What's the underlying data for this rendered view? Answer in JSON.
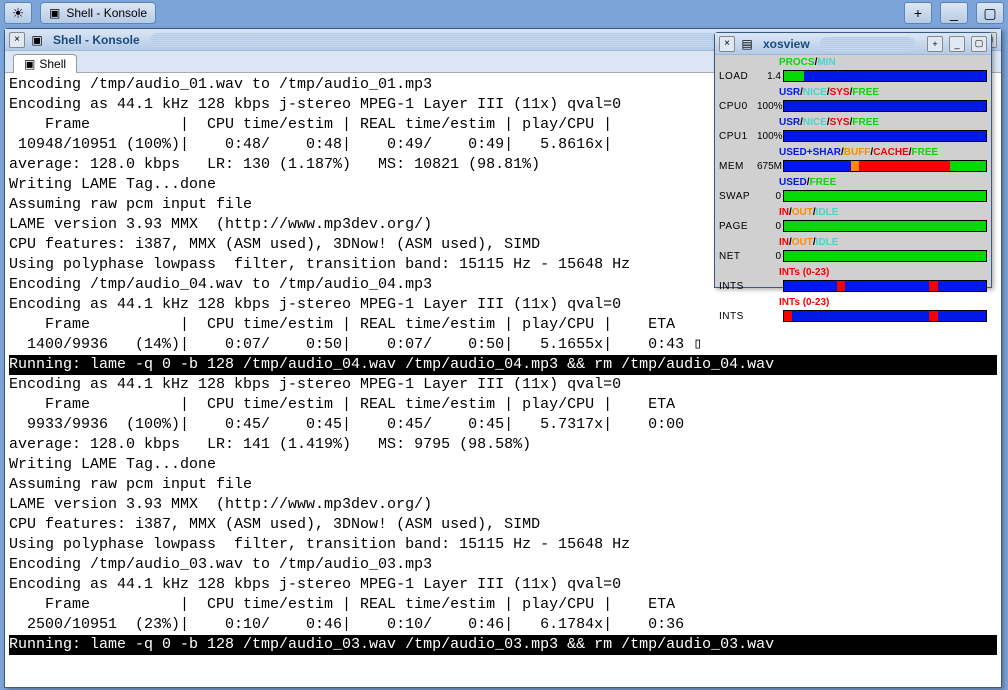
{
  "taskbar": {
    "items": [
      {
        "label": "Shell - Konsole",
        "glyph": "▣"
      }
    ]
  },
  "konsole": {
    "title": "Shell - Konsole",
    "tab_label": "Shell",
    "lines": [
      "Encoding /tmp/audio_01.wav to /tmp/audio_01.mp3",
      "Encoding as 44.1 kHz 128 kbps j-stereo MPEG-1 Layer III (11x) qval=0",
      "    Frame          |  CPU time/estim | REAL time/estim | play/CPU |",
      " 10948/10951 (100%)|    0:48/    0:48|    0:49/    0:49|   5.8616x|",
      "average: 128.0 kbps   LR: 130 (1.187%)   MS: 10821 (98.81%)",
      "",
      "Writing LAME Tag...done",
      "Assuming raw pcm input file",
      "LAME version 3.93 MMX  (http://www.mp3dev.org/)",
      "CPU features: i387, MMX (ASM used), 3DNow! (ASM used), SIMD",
      "Using polyphase lowpass  filter, transition band: 15115 Hz - 15648 Hz",
      "Encoding /tmp/audio_04.wav to /tmp/audio_04.mp3",
      "Encoding as 44.1 kHz 128 kbps j-stereo MPEG-1 Layer III (11x) qval=0",
      "    Frame          |  CPU time/estim | REAL time/estim | play/CPU |    ETA",
      "  1400/9936   (14%)|    0:07/    0:50|    0:07/    0:50|   5.1655x|    0:43 ▯",
      "Running: lame -q 0 -b 128 /tmp/audio_04.wav /tmp/audio_04.mp3 && rm /tmp/audio_04.wav",
      "Encoding as 44.1 kHz 128 kbps j-stereo MPEG-1 Layer III (11x) qval=0",
      "    Frame          |  CPU time/estim | REAL time/estim | play/CPU |    ETA",
      "  9933/9936  (100%)|    0:45/    0:45|    0:45/    0:45|   5.7317x|    0:00",
      "average: 128.0 kbps   LR: 141 (1.419%)   MS: 9795 (98.58%)",
      "",
      "Writing LAME Tag...done",
      "Assuming raw pcm input file",
      "LAME version 3.93 MMX  (http://www.mp3dev.org/)",
      "CPU features: i387, MMX (ASM used), 3DNow! (ASM used), SIMD",
      "Using polyphase lowpass  filter, transition band: 15115 Hz - 15648 Hz",
      "Encoding /tmp/audio_03.wav to /tmp/audio_03.mp3",
      "Encoding as 44.1 kHz 128 kbps j-stereo MPEG-1 Layer III (11x) qval=0",
      "    Frame          |  CPU time/estim | REAL time/estim | play/CPU |    ETA",
      "  2500/10951  (23%)|    0:10/    0:46|    0:10/    0:46|   6.1784x|    0:36",
      "Running: lame -q 0 -b 128 /tmp/audio_03.wav /tmp/audio_03.mp3 && rm /tmp/audio_03.wav"
    ],
    "inverse_line_indices": [
      15,
      30
    ]
  },
  "xosview": {
    "title": "xosview",
    "rows": [
      {
        "legend": [
          [
            "PROCS",
            "#06d806"
          ],
          [
            "/",
            ""
          ],
          [
            "MIN",
            "#4ad4c8"
          ]
        ],
        "label": "LOAD",
        "value": "1.4",
        "segments": [
          [
            "c-green",
            10
          ],
          [
            "c-blue",
            90
          ]
        ]
      },
      {
        "legend": [
          [
            "USR",
            "#0018e8"
          ],
          [
            "/",
            ""
          ],
          [
            "NICE",
            "#4ad4c8"
          ],
          [
            "/",
            ""
          ],
          [
            "SYS",
            "#f80000"
          ],
          [
            "/",
            ""
          ],
          [
            "FREE",
            "#06d806"
          ]
        ],
        "label": "CPU0",
        "value": "100%",
        "segments": [
          [
            "c-blue",
            100
          ]
        ]
      },
      {
        "legend": [
          [
            "USR",
            "#0018e8"
          ],
          [
            "/",
            ""
          ],
          [
            "NICE",
            "#4ad4c8"
          ],
          [
            "/",
            ""
          ],
          [
            "SYS",
            "#f80000"
          ],
          [
            "/",
            ""
          ],
          [
            "FREE",
            "#06d806"
          ]
        ],
        "label": "CPU1",
        "value": "100%",
        "segments": [
          [
            "c-blue",
            100
          ]
        ]
      },
      {
        "legend": [
          [
            "USED+SHAR",
            "#0018e8"
          ],
          [
            "/",
            ""
          ],
          [
            "BUFF",
            "#ff8a00"
          ],
          [
            "/",
            ""
          ],
          [
            "CACHE",
            "#f80000"
          ],
          [
            "/",
            ""
          ],
          [
            "FREE",
            "#06d806"
          ]
        ],
        "label": "MEM",
        "value": "675M",
        "segments": [
          [
            "c-blue",
            33
          ],
          [
            "c-orange",
            4
          ],
          [
            "c-red",
            45
          ],
          [
            "c-green",
            18
          ]
        ]
      },
      {
        "legend": [
          [
            "USED",
            "#0018e8"
          ],
          [
            "/",
            ""
          ],
          [
            "FREE",
            "#06d806"
          ]
        ],
        "label": "SWAP",
        "value": "0",
        "segments": [
          [
            "c-green",
            100
          ]
        ]
      },
      {
        "legend": [
          [
            "IN",
            "#f80000"
          ],
          [
            "/",
            ""
          ],
          [
            "OUT",
            "#ff8a00"
          ],
          [
            "/",
            ""
          ],
          [
            "IDLE",
            "#4ad4c8"
          ]
        ],
        "label": "PAGE",
        "value": "0",
        "segments": [
          [
            "c-green",
            100
          ]
        ]
      },
      {
        "legend": [
          [
            "IN",
            "#f80000"
          ],
          [
            "/",
            ""
          ],
          [
            "OUT",
            "#ff8a00"
          ],
          [
            "/",
            ""
          ],
          [
            "IDLE",
            "#4ad4c8"
          ]
        ],
        "label": "NET",
        "value": "0",
        "segments": [
          [
            "c-green",
            100
          ]
        ]
      },
      {
        "legend": [
          [
            "INTs (0-23)",
            "#f80000"
          ]
        ],
        "label": "INTS",
        "value": "",
        "segments": [
          [
            "c-blue",
            26
          ],
          [
            "c-red",
            4
          ],
          [
            "c-blue",
            42
          ],
          [
            "c-red",
            4
          ],
          [
            "c-blue",
            24
          ]
        ]
      },
      {
        "legend": [
          [
            "INTs (0-23)",
            "#f80000"
          ]
        ],
        "label": "INTS",
        "value": "",
        "segments": [
          [
            "c-red",
            4
          ],
          [
            "c-blue",
            68
          ],
          [
            "c-red",
            4
          ],
          [
            "c-blue",
            24
          ]
        ]
      }
    ]
  }
}
